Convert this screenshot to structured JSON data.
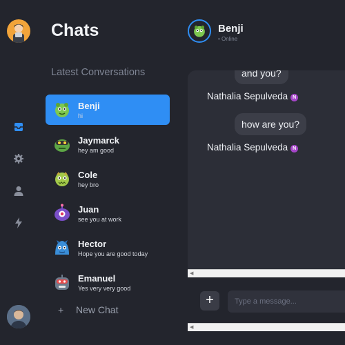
{
  "sidebar": {
    "nav_icons": [
      "inbox-icon",
      "gear-icon",
      "user-icon",
      "lightning-icon"
    ]
  },
  "panel": {
    "title": "Chats",
    "subtitle": "Latest Conversations",
    "conversations": [
      {
        "name": "Benji",
        "message": "hi",
        "active": true,
        "color": "#7ec850"
      },
      {
        "name": "Jaymarck",
        "message": "hey am good",
        "active": false,
        "color": "#5da646"
      },
      {
        "name": "Cole",
        "message": "hey bro",
        "active": false,
        "color": "#a3c94a"
      },
      {
        "name": "Juan",
        "message": "see you at work",
        "active": false,
        "color": "#7a4fc9"
      },
      {
        "name": "Hector",
        "message": "Hope you are good today",
        "active": false,
        "color": "#3a8ed8"
      },
      {
        "name": "Emanuel",
        "message": "Yes very very good",
        "active": false,
        "color": "#6d7b8c"
      }
    ],
    "new_chat_label": "New Chat"
  },
  "chat": {
    "contact_name": "Benji",
    "contact_status": "• Online",
    "messages": [
      {
        "text": "and you?",
        "sender": "Nathalia Sepulveda",
        "badge": "N"
      },
      {
        "text": "how are you?",
        "sender": "Nathalia Sepulveda",
        "badge": "N"
      }
    ],
    "composer_placeholder": "Type a message..."
  },
  "colors": {
    "accent": "#2f8ef4",
    "background": "#23252d",
    "message_area": "#2c2e37",
    "badge": "#a646c9"
  }
}
